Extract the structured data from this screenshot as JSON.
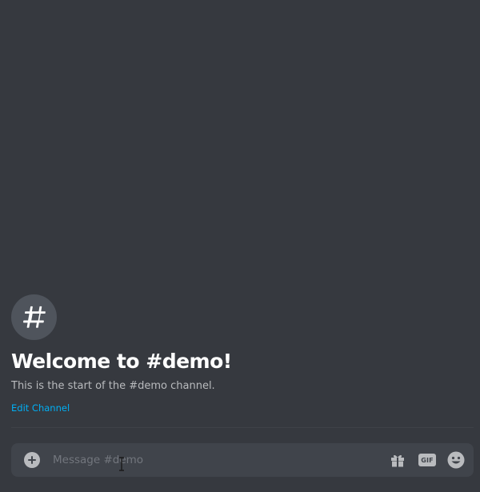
{
  "channel": {
    "icon": "hashtag-icon",
    "welcome_title": "Welcome to #demo!",
    "welcome_subtitle": "This is the start of the #demo channel.",
    "edit_link": "Edit Channel"
  },
  "composer": {
    "placeholder": "Message #demo",
    "value": "",
    "icons": {
      "attach": "plus-circle-icon",
      "gift": "gift-icon",
      "gif_label": "GIF",
      "emoji": "smiley-icon"
    }
  },
  "colors": {
    "background": "#36393f",
    "composer_bg": "#40444b",
    "accent_link": "#00aff4",
    "icon_circle": "#4f545c",
    "muted_icon": "#b9bbbe"
  }
}
